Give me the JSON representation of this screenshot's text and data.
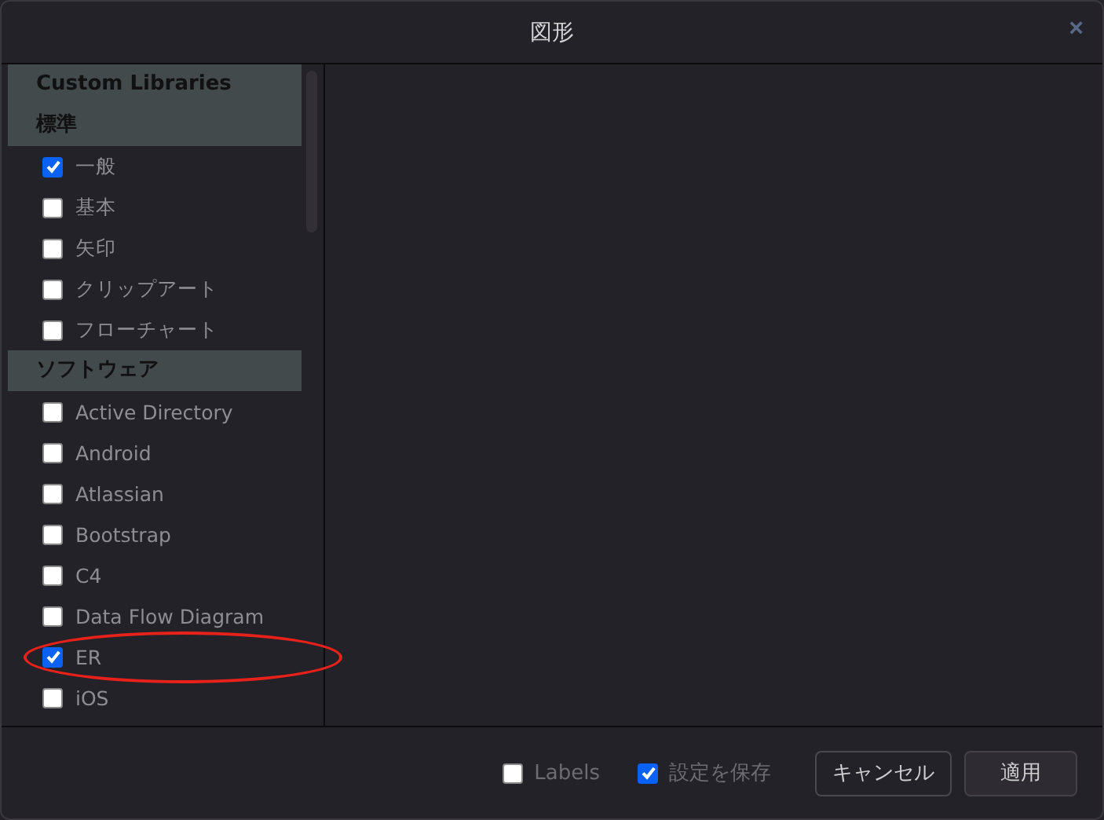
{
  "window": {
    "title": "図形",
    "close": "×"
  },
  "sections": [
    {
      "title": "Custom Libraries"
    },
    {
      "title": "標準",
      "items": [
        {
          "label": "一般",
          "checked": true,
          "circled": false
        },
        {
          "label": "基本",
          "checked": false,
          "circled": false
        },
        {
          "label": "矢印",
          "checked": false,
          "circled": false
        },
        {
          "label": "クリップアート",
          "checked": false,
          "circled": false
        },
        {
          "label": "フローチャート",
          "checked": false,
          "circled": false
        }
      ]
    },
    {
      "title": "ソフトウェア",
      "items": [
        {
          "label": "Active Directory",
          "checked": false,
          "circled": false
        },
        {
          "label": "Android",
          "checked": false,
          "circled": false
        },
        {
          "label": "Atlassian",
          "checked": false,
          "circled": false
        },
        {
          "label": "Bootstrap",
          "checked": false,
          "circled": false
        },
        {
          "label": "C4",
          "checked": false,
          "circled": false
        },
        {
          "label": "Data Flow Diagram",
          "checked": false,
          "circled": false
        },
        {
          "label": "ER",
          "checked": true,
          "circled": true
        },
        {
          "label": "iOS",
          "checked": false,
          "circled": false
        }
      ]
    }
  ],
  "footer": {
    "options": [
      {
        "label": "Labels",
        "checked": false
      },
      {
        "label": "設定を保存",
        "checked": true
      }
    ],
    "buttons": [
      {
        "label": "キャンセル",
        "kind": "secondary"
      },
      {
        "label": "適用",
        "kind": "primary"
      }
    ]
  }
}
